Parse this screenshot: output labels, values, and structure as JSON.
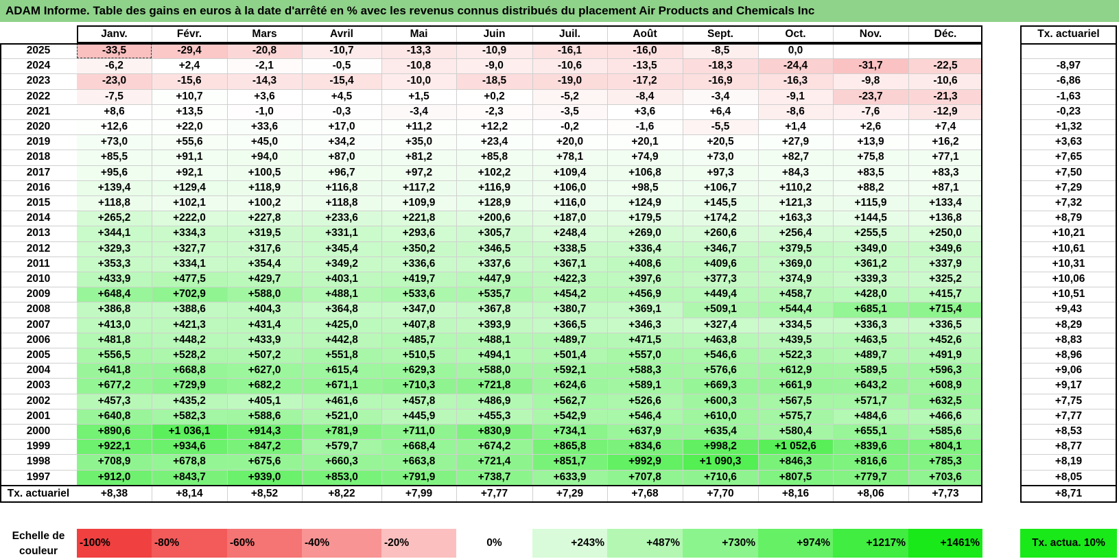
{
  "title": "ADAM Informe. Table des gains en euros à la date d'arrêté en % avec les revenus connus distribués du placement Air Products and Chemicals Inc",
  "months": [
    "Janv.",
    "Févr.",
    "Mars",
    "Avril",
    "Mai",
    "Juin",
    "Juil.",
    "Août",
    "Sept.",
    "Oct.",
    "Nov.",
    "Déc."
  ],
  "rate_header": "Tx. actuariel",
  "rows": [
    {
      "year": "2025",
      "v": [
        "-33,5",
        "-29,4",
        "-20,8",
        "-10,7",
        "-13,3",
        "-10,9",
        "-16,1",
        "-16,0",
        "-8,5",
        "0,0",
        "",
        ""
      ],
      "rate": ""
    },
    {
      "year": "2024",
      "v": [
        "-6,2",
        "+2,4",
        "-2,1",
        "-0,5",
        "-10,8",
        "-9,0",
        "-10,6",
        "-13,5",
        "-18,3",
        "-24,4",
        "-31,7",
        "-22,5"
      ],
      "rate": "-8,97"
    },
    {
      "year": "2023",
      "v": [
        "-23,0",
        "-15,6",
        "-14,3",
        "-15,4",
        "-10,0",
        "-18,5",
        "-19,0",
        "-17,2",
        "-16,9",
        "-16,3",
        "-9,8",
        "-10,6"
      ],
      "rate": "-6,86"
    },
    {
      "year": "2022",
      "v": [
        "-7,5",
        "+10,7",
        "+3,6",
        "+4,5",
        "+1,5",
        "+0,2",
        "-5,2",
        "-8,4",
        "-3,4",
        "-9,1",
        "-23,7",
        "-21,3"
      ],
      "rate": "-1,63"
    },
    {
      "year": "2021",
      "v": [
        "+8,6",
        "+13,5",
        "-1,0",
        "-0,3",
        "-3,4",
        "-2,3",
        "-3,5",
        "+3,6",
        "+6,4",
        "-8,6",
        "-7,6",
        "-12,9"
      ],
      "rate": "-0,23"
    },
    {
      "year": "2020",
      "v": [
        "+12,6",
        "+22,0",
        "+33,6",
        "+17,0",
        "+11,2",
        "+12,2",
        "-0,2",
        "-1,6",
        "-5,5",
        "+1,4",
        "+2,6",
        "+7,4"
      ],
      "rate": "+1,32"
    },
    {
      "year": "2019",
      "v": [
        "+73,0",
        "+55,6",
        "+45,0",
        "+34,2",
        "+35,0",
        "+23,4",
        "+20,0",
        "+20,1",
        "+20,5",
        "+27,9",
        "+13,9",
        "+16,2"
      ],
      "rate": "+3,63"
    },
    {
      "year": "2018",
      "v": [
        "+85,5",
        "+91,1",
        "+94,0",
        "+87,0",
        "+81,2",
        "+85,8",
        "+78,1",
        "+74,9",
        "+73,0",
        "+82,7",
        "+75,8",
        "+77,1"
      ],
      "rate": "+7,65"
    },
    {
      "year": "2017",
      "v": [
        "+95,6",
        "+92,1",
        "+100,5",
        "+96,7",
        "+97,2",
        "+102,2",
        "+109,4",
        "+106,8",
        "+97,3",
        "+84,3",
        "+83,5",
        "+83,3"
      ],
      "rate": "+7,50"
    },
    {
      "year": "2016",
      "v": [
        "+139,4",
        "+129,4",
        "+118,9",
        "+116,8",
        "+117,2",
        "+116,9",
        "+106,0",
        "+98,5",
        "+106,7",
        "+110,2",
        "+88,2",
        "+87,1"
      ],
      "rate": "+7,29"
    },
    {
      "year": "2015",
      "v": [
        "+118,8",
        "+102,1",
        "+100,2",
        "+118,8",
        "+109,9",
        "+128,9",
        "+116,0",
        "+124,9",
        "+145,5",
        "+121,3",
        "+115,9",
        "+133,4"
      ],
      "rate": "+7,32"
    },
    {
      "year": "2014",
      "v": [
        "+265,2",
        "+222,0",
        "+227,8",
        "+233,6",
        "+221,8",
        "+200,6",
        "+187,0",
        "+179,5",
        "+174,2",
        "+163,3",
        "+144,5",
        "+136,8"
      ],
      "rate": "+8,79"
    },
    {
      "year": "2013",
      "v": [
        "+344,1",
        "+334,3",
        "+319,5",
        "+331,1",
        "+293,6",
        "+305,7",
        "+248,4",
        "+269,0",
        "+260,6",
        "+256,4",
        "+255,5",
        "+250,0"
      ],
      "rate": "+10,21"
    },
    {
      "year": "2012",
      "v": [
        "+329,3",
        "+327,7",
        "+317,6",
        "+345,4",
        "+350,2",
        "+346,5",
        "+338,5",
        "+336,4",
        "+346,7",
        "+379,5",
        "+349,0",
        "+349,6"
      ],
      "rate": "+10,61"
    },
    {
      "year": "2011",
      "v": [
        "+353,3",
        "+334,1",
        "+354,4",
        "+349,2",
        "+336,6",
        "+337,6",
        "+367,1",
        "+408,6",
        "+409,6",
        "+369,0",
        "+361,2",
        "+337,9"
      ],
      "rate": "+10,31"
    },
    {
      "year": "2010",
      "v": [
        "+433,9",
        "+477,5",
        "+429,7",
        "+403,1",
        "+419,7",
        "+447,9",
        "+422,3",
        "+397,6",
        "+377,3",
        "+374,9",
        "+339,3",
        "+325,2"
      ],
      "rate": "+10,06"
    },
    {
      "year": "2009",
      "v": [
        "+648,4",
        "+702,9",
        "+588,0",
        "+488,1",
        "+533,6",
        "+535,7",
        "+454,2",
        "+456,9",
        "+449,4",
        "+458,7",
        "+428,0",
        "+415,7"
      ],
      "rate": "+10,51"
    },
    {
      "year": "2008",
      "v": [
        "+386,8",
        "+388,6",
        "+404,3",
        "+364,8",
        "+347,0",
        "+367,8",
        "+380,7",
        "+369,1",
        "+509,1",
        "+544,4",
        "+685,1",
        "+715,4"
      ],
      "rate": "+9,43"
    },
    {
      "year": "2007",
      "v": [
        "+413,0",
        "+421,3",
        "+431,4",
        "+425,0",
        "+407,8",
        "+393,9",
        "+366,5",
        "+346,3",
        "+327,4",
        "+334,5",
        "+336,3",
        "+336,5"
      ],
      "rate": "+8,29"
    },
    {
      "year": "2006",
      "v": [
        "+481,8",
        "+448,2",
        "+433,9",
        "+442,8",
        "+485,7",
        "+488,1",
        "+489,7",
        "+471,5",
        "+463,8",
        "+439,5",
        "+463,5",
        "+452,6"
      ],
      "rate": "+8,83"
    },
    {
      "year": "2005",
      "v": [
        "+556,5",
        "+528,2",
        "+507,2",
        "+551,8",
        "+510,5",
        "+494,1",
        "+501,4",
        "+557,0",
        "+546,6",
        "+522,3",
        "+489,7",
        "+491,9"
      ],
      "rate": "+8,96"
    },
    {
      "year": "2004",
      "v": [
        "+641,8",
        "+668,8",
        "+627,0",
        "+615,4",
        "+629,3",
        "+588,0",
        "+592,1",
        "+588,3",
        "+576,6",
        "+612,9",
        "+589,5",
        "+596,3"
      ],
      "rate": "+9,06"
    },
    {
      "year": "2003",
      "v": [
        "+677,2",
        "+729,9",
        "+682,2",
        "+671,1",
        "+710,3",
        "+721,8",
        "+624,6",
        "+589,1",
        "+669,3",
        "+661,9",
        "+643,2",
        "+608,9"
      ],
      "rate": "+9,17"
    },
    {
      "year": "2002",
      "v": [
        "+457,3",
        "+435,2",
        "+405,1",
        "+461,6",
        "+457,8",
        "+486,9",
        "+562,7",
        "+526,6",
        "+600,3",
        "+567,5",
        "+571,7",
        "+632,5"
      ],
      "rate": "+7,75"
    },
    {
      "year": "2001",
      "v": [
        "+640,8",
        "+582,3",
        "+588,6",
        "+521,0",
        "+445,9",
        "+455,3",
        "+542,9",
        "+546,4",
        "+610,0",
        "+575,7",
        "+484,6",
        "+466,6"
      ],
      "rate": "+7,77"
    },
    {
      "year": "2000",
      "v": [
        "+890,6",
        "+1 036,1",
        "+914,3",
        "+781,9",
        "+711,0",
        "+830,9",
        "+734,1",
        "+637,9",
        "+635,4",
        "+580,4",
        "+655,1",
        "+585,6"
      ],
      "rate": "+8,53"
    },
    {
      "year": "1999",
      "v": [
        "+922,1",
        "+934,6",
        "+847,2",
        "+579,7",
        "+668,4",
        "+674,2",
        "+865,8",
        "+834,6",
        "+998,2",
        "+1 052,6",
        "+839,6",
        "+804,1"
      ],
      "rate": "+8,77"
    },
    {
      "year": "1998",
      "v": [
        "+708,9",
        "+678,8",
        "+675,6",
        "+660,3",
        "+663,8",
        "+721,4",
        "+851,7",
        "+992,9",
        "+1 090,3",
        "+846,3",
        "+816,6",
        "+785,3"
      ],
      "rate": "+8,19"
    },
    {
      "year": "1997",
      "v": [
        "+912,0",
        "+843,7",
        "+939,0",
        "+853,0",
        "+791,9",
        "+738,7",
        "+633,9",
        "+707,8",
        "+710,6",
        "+807,5",
        "+779,7",
        "+703,6"
      ],
      "rate": "+8,05"
    }
  ],
  "footer": {
    "label": "Tx. actuariel",
    "values": [
      "+8,38",
      "+8,14",
      "+8,52",
      "+8,22",
      "+7,99",
      "+7,77",
      "+7,29",
      "+7,68",
      "+7,70",
      "+8,16",
      "+8,06",
      "+7,73"
    ],
    "total": "+8,71"
  },
  "legend": {
    "label": "Echelle de couleur",
    "scale": [
      {
        "text": "-100%",
        "color": "#f04040"
      },
      {
        "text": "-80%",
        "color": "#f35a5a"
      },
      {
        "text": "-60%",
        "color": "#f57474"
      },
      {
        "text": "-40%",
        "color": "#f89494"
      },
      {
        "text": "-20%",
        "color": "#fbbfbf"
      },
      {
        "text": "0%",
        "color": "#ffffff"
      },
      {
        "text": "+243%",
        "color": "#d9fbd9"
      },
      {
        "text": "+487%",
        "color": "#b3f7b3"
      },
      {
        "text": "+730%",
        "color": "#8cf48c"
      },
      {
        "text": "+974%",
        "color": "#66f066"
      },
      {
        "text": "+1217%",
        "color": "#40ed40"
      },
      {
        "text": "+1461%",
        "color": "#19e919"
      }
    ],
    "rate_label": "Tx. actua. 10%",
    "rate_color": "#19e919"
  }
}
